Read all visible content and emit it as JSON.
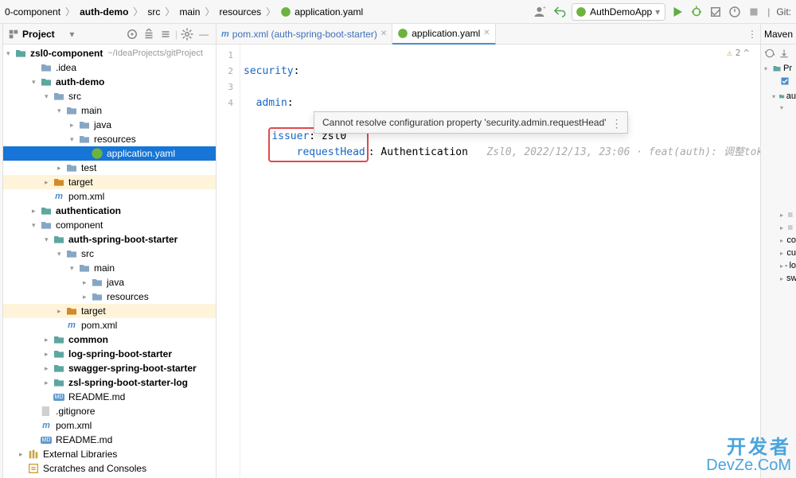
{
  "breadcrumb": {
    "items": [
      {
        "label": "0-component",
        "icon": "folder"
      },
      {
        "label": "auth-demo",
        "icon": "folder-bold"
      },
      {
        "label": "src",
        "icon": "folder"
      },
      {
        "label": "main",
        "icon": "folder"
      },
      {
        "label": "resources",
        "icon": "folder"
      },
      {
        "label": "application.yaml",
        "icon": "spring"
      }
    ]
  },
  "run_config": "AuthDemoApp",
  "nav_git": "Git:",
  "project": {
    "title": "Project",
    "root_path": "~/IdeaProjects/gitProject"
  },
  "tree": {
    "root": {
      "label": "zsl0-component",
      "bold": true
    },
    "items": [
      {
        "depth": 1,
        "arrow": "none",
        "icon": "folder",
        "label": ".idea"
      },
      {
        "depth": 1,
        "arrow": "expanded",
        "icon": "folder-teal",
        "label": "auth-demo",
        "bold": true
      },
      {
        "depth": 2,
        "arrow": "expanded",
        "icon": "folder",
        "label": "src"
      },
      {
        "depth": 3,
        "arrow": "expanded",
        "icon": "folder",
        "label": "main"
      },
      {
        "depth": 4,
        "arrow": "collapsed",
        "icon": "folder",
        "label": "java"
      },
      {
        "depth": 4,
        "arrow": "expanded",
        "icon": "folder",
        "label": "resources"
      },
      {
        "depth": 5,
        "arrow": "none",
        "icon": "spring",
        "label": "application.yaml",
        "selected": true
      },
      {
        "depth": 3,
        "arrow": "collapsed",
        "icon": "folder",
        "label": "test"
      },
      {
        "depth": 2,
        "arrow": "collapsed",
        "icon": "folder-orange",
        "label": "target",
        "highlight": true
      },
      {
        "depth": 2,
        "arrow": "none",
        "icon": "maven",
        "label": "pom.xml"
      },
      {
        "depth": 1,
        "arrow": "collapsed",
        "icon": "folder-teal",
        "label": "authentication",
        "bold": true
      },
      {
        "depth": 1,
        "arrow": "expanded",
        "icon": "folder",
        "label": "component"
      },
      {
        "depth": 2,
        "arrow": "expanded",
        "icon": "folder-teal",
        "label": "auth-spring-boot-starter",
        "bold": true
      },
      {
        "depth": 3,
        "arrow": "expanded",
        "icon": "folder",
        "label": "src"
      },
      {
        "depth": 4,
        "arrow": "expanded",
        "icon": "folder",
        "label": "main"
      },
      {
        "depth": 5,
        "arrow": "collapsed",
        "icon": "folder",
        "label": "java"
      },
      {
        "depth": 5,
        "arrow": "collapsed",
        "icon": "folder",
        "label": "resources"
      },
      {
        "depth": 3,
        "arrow": "collapsed",
        "icon": "folder-orange",
        "label": "target",
        "highlight": true
      },
      {
        "depth": 3,
        "arrow": "none",
        "icon": "maven",
        "label": "pom.xml"
      },
      {
        "depth": 2,
        "arrow": "collapsed",
        "icon": "folder-teal",
        "label": "common",
        "bold": true
      },
      {
        "depth": 2,
        "arrow": "collapsed",
        "icon": "folder-teal",
        "label": "log-spring-boot-starter",
        "bold": true
      },
      {
        "depth": 2,
        "arrow": "collapsed",
        "icon": "folder-teal",
        "label": "swagger-spring-boot-starter",
        "bold": true
      },
      {
        "depth": 2,
        "arrow": "collapsed",
        "icon": "folder-teal",
        "label": "zsl-spring-boot-starter-log",
        "bold": true
      },
      {
        "depth": 2,
        "arrow": "none",
        "icon": "md",
        "label": "README.md"
      },
      {
        "depth": 1,
        "arrow": "none",
        "icon": "gitignore",
        "label": ".gitignore"
      },
      {
        "depth": 1,
        "arrow": "none",
        "icon": "maven",
        "label": "pom.xml"
      },
      {
        "depth": 1,
        "arrow": "none",
        "icon": "md",
        "label": "README.md"
      },
      {
        "depth": 0,
        "arrow": "collapsed",
        "icon": "lib",
        "label": "External Libraries"
      },
      {
        "depth": 0,
        "arrow": "none",
        "icon": "scratch",
        "label": "Scratches and Consoles"
      }
    ]
  },
  "tabs": [
    {
      "label": "pom.xml (auth-spring-boot-starter)",
      "icon": "maven",
      "active": false
    },
    {
      "label": "application.yaml",
      "icon": "spring",
      "active": true
    }
  ],
  "editor": {
    "lines": [
      "1",
      "2",
      "3",
      "4"
    ],
    "code": {
      "l1_key": "security",
      "l1_colon": ":",
      "l2_key": "admin",
      "l2_colon": ":",
      "l3_key": "issuer",
      "l3_rest": ": zsl0",
      "l4_key": "requestHead",
      "l4_colon": ":",
      "l4_val": " Authentication",
      "l4_annot_author": "Zsl0, 2022/12/13, 23:06",
      "l4_annot_msg": " · feat(auth): 调整token工具包 (pro"
    },
    "status": {
      "warn_count": "2",
      "wave": "^"
    }
  },
  "tooltip": {
    "text": "Cannot resolve configuration property 'security.admin.requestHead'"
  },
  "maven": {
    "title": "Maven",
    "items": [
      {
        "label": "Pr",
        "icon": "folder-teal",
        "arrow": "expanded",
        "depth": 0
      },
      {
        "label": "",
        "icon": "",
        "arrow": "none",
        "depth": 1,
        "checkbox": true
      },
      {
        "label": "au",
        "icon": "folder-teal",
        "arrow": "expanded",
        "depth": 1
      },
      {
        "label": "",
        "icon": "",
        "arrow": "expanded",
        "depth": 2
      },
      {
        "label": "",
        "icon": "",
        "arrow": "none",
        "depth": 0,
        "gap": true
      },
      {
        "label": "",
        "icon": "bars",
        "arrow": "collapsed",
        "depth": 2
      },
      {
        "label": "",
        "icon": "bars",
        "arrow": "collapsed",
        "depth": 2
      },
      {
        "label": "co",
        "icon": "folder-teal",
        "arrow": "collapsed",
        "depth": 2
      },
      {
        "label": "cu",
        "icon": "folder-teal",
        "arrow": "collapsed",
        "depth": 2
      },
      {
        "label": "lo",
        "icon": "folder-teal",
        "arrow": "collapsed",
        "depth": 2
      },
      {
        "label": "sw",
        "icon": "folder-teal",
        "arrow": "collapsed",
        "depth": 2
      }
    ]
  },
  "watermark": {
    "line1": "开发者",
    "line2": "DevZe.CoM"
  }
}
